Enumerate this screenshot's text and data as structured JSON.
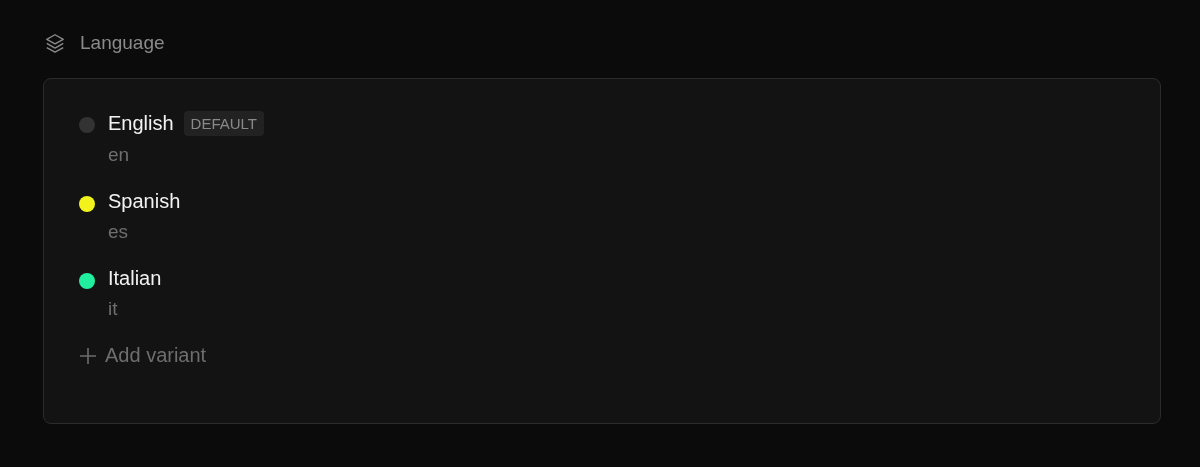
{
  "section": {
    "title": "Language"
  },
  "variants": [
    {
      "name": "English",
      "code": "en",
      "badge": "DEFAULT",
      "color": "#333333"
    },
    {
      "name": "Spanish",
      "code": "es",
      "color": "#f2f21c"
    },
    {
      "name": "Italian",
      "code": "it",
      "color": "#22eea0"
    }
  ],
  "add_button": {
    "label": "Add variant"
  }
}
